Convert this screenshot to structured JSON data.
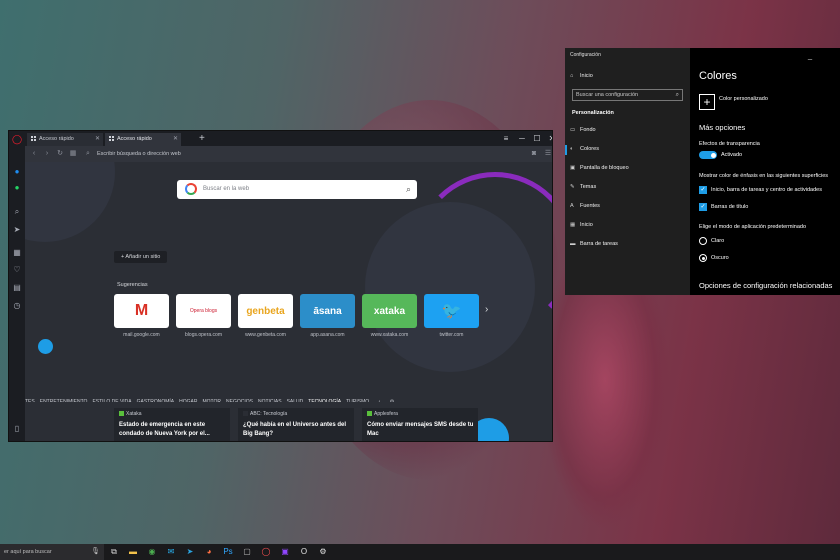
{
  "opera": {
    "tabs": [
      {
        "label": "Acceso rápido",
        "close": "✕"
      },
      {
        "label": "Acceso rápido",
        "close": "✕"
      }
    ],
    "new_tab": "+",
    "window_controls": {
      "menu": "≡",
      "minimize": "─",
      "maximize": "☐",
      "close": "✕"
    },
    "address_placeholder": "Escribir búsqueda o dirección web",
    "search_placeholder": "Buscar en la web",
    "add_site": "+ Añadir un sitio",
    "suggestions_label": "Sugerencias",
    "speed_dials": [
      {
        "caption": "mail.google.com",
        "logo": "M",
        "bg": "#ffffff",
        "fg": "#d93025"
      },
      {
        "caption": "blogs.opera.com",
        "logo": "Opera blogs",
        "bg": "#ffffff",
        "fg": "#cc1a2e"
      },
      {
        "caption": "www.genbeta.com",
        "logo": "genbeta",
        "bg": "#ffffff",
        "fg": "#e9a51e"
      },
      {
        "caption": "app.asana.com",
        "logo": "āsana",
        "bg": "#2c8ec9",
        "fg": "#ffffff"
      },
      {
        "caption": "www.xataka.com",
        "logo": "xataka",
        "bg": "#56b85a",
        "fg": "#ffffff"
      },
      {
        "caption": "twitter.com",
        "logo": "🐦",
        "bg": "#1da1f2",
        "fg": "#ffffff"
      }
    ],
    "news_categories": [
      "TES",
      "ENTRETENIMIENTO",
      "ESTILO DE VIDA",
      "GASTRONOMÍA",
      "HOGAR",
      "MOTOR",
      "NEGOCIOS",
      "NOTICIAS",
      "SALUD",
      "TECNOLOGÍA",
      "TURISMO"
    ],
    "selected_category": "TECNOLOGÍA",
    "news": [
      {
        "source": "Xataka",
        "title": "Estado de emergencia en este condado de Nueva York por el..."
      },
      {
        "source": "ABC: Tecnología",
        "title": "¿Qué había en el Universo antes del Big Bang?"
      },
      {
        "source": "Applesfera",
        "title": "Cómo enviar mensajes SMS desde tu Mac"
      }
    ]
  },
  "settings": {
    "window_title": "Configuración",
    "home": "Inicio",
    "search_placeholder": "Buscar una configuración",
    "section": "Personalización",
    "nav": [
      "Fondo",
      "Colores",
      "Pantalla de bloqueo",
      "Temas",
      "Fuentes",
      "Inicio",
      "Barra de tareas"
    ],
    "selected_nav": "Colores",
    "page_title": "Colores",
    "custom_color": "Color personalizado",
    "more_options": "Más opciones",
    "transparency_label": "Efectos de transparencia",
    "transparency_state": "Activado",
    "accent_label": "Mostrar color de énfasis en las siguientes superficies",
    "accent_option_1": "Inicio, barra de tareas y centro de actividades",
    "accent_option_2": "Barras de título",
    "mode_label": "Elige el modo de aplicación predeterminado",
    "mode_light": "Claro",
    "mode_dark": "Oscuro",
    "related": "Opciones de configuración relacionadas",
    "minimize": "─"
  },
  "taskbar": {
    "search_placeholder": "er aquí para buscar"
  },
  "colors": {
    "accent": "#1e9de6",
    "opera_bg": "#2b2e35",
    "settings_bg": "#000000"
  }
}
